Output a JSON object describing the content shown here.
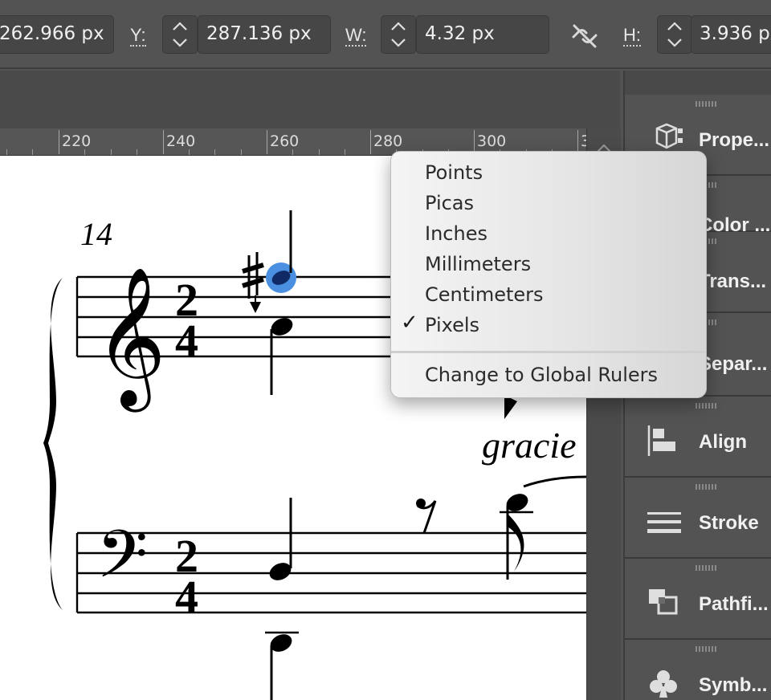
{
  "control_bar": {
    "x_value": "262.966 px",
    "y_label": "Y:",
    "y_value": "287.136 px",
    "w_label": "W:",
    "w_value": "4.32 px",
    "h_label": "H:",
    "h_value": "3.936 px"
  },
  "ruler": {
    "labels": [
      "220",
      "240",
      "260",
      "280",
      "300",
      "3"
    ]
  },
  "score": {
    "measure_number": "14",
    "expression": "gracie"
  },
  "units_menu": {
    "items": [
      "Points",
      "Picas",
      "Inches",
      "Millimeters",
      "Centimeters",
      "Pixels"
    ],
    "checked": "Pixels",
    "checkmark": "✓",
    "global_rulers": "Change to Global Rulers"
  },
  "panels": {
    "items": [
      {
        "label": "Prope...",
        "icon": "cube-icon"
      },
      {
        "label": "Color ...",
        "icon": "color-icon"
      },
      {
        "label": "Trans...",
        "icon": "transparency-icon"
      },
      {
        "label": "Separ...",
        "icon": "separations-icon"
      },
      {
        "label": "Align",
        "icon": "align-icon"
      },
      {
        "label": "Stroke",
        "icon": "stroke-icon"
      },
      {
        "label": "Pathfi...",
        "icon": "pathfinder-icon"
      },
      {
        "label": "Symb...",
        "icon": "club-icon"
      }
    ]
  }
}
